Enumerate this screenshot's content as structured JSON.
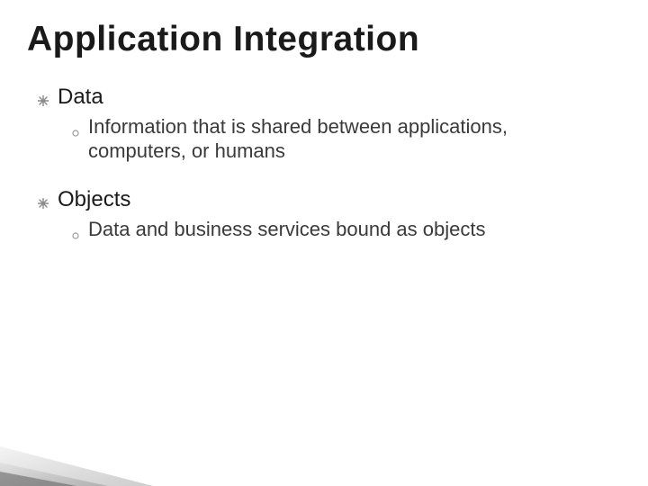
{
  "title": "Application Integration",
  "sections": [
    {
      "heading": "Data",
      "sub": "Information that is shared between applications, computers, or humans"
    },
    {
      "heading": "Objects",
      "sub": "Data and business services bound as objects"
    }
  ]
}
